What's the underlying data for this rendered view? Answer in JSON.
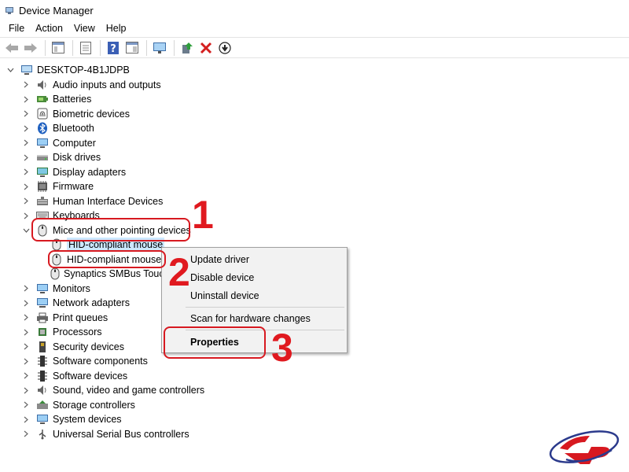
{
  "window": {
    "title": "Device Manager"
  },
  "menu": [
    "File",
    "Action",
    "View",
    "Help"
  ],
  "toolbar": [
    "back-icon",
    "forward-icon",
    "show-hide-console-tree-icon",
    "properties-icon",
    "help-icon",
    "action-pane-icon",
    "monitor-icon",
    "update-driver-icon",
    "uninstall-icon",
    "download-icon"
  ],
  "tree": {
    "root": "DESKTOP-4B1JDPB",
    "categories": [
      "Audio inputs and outputs",
      "Batteries",
      "Biometric devices",
      "Bluetooth",
      "Computer",
      "Disk drives",
      "Display adapters",
      "Firmware",
      "Human Interface Devices",
      "Keyboards",
      "Mice and other pointing devices",
      "Monitors",
      "Network adapters",
      "Print queues",
      "Processors",
      "Security devices",
      "Software components",
      "Software devices",
      "Sound, video and game controllers",
      "Storage controllers",
      "System devices",
      "Universal Serial Bus controllers"
    ],
    "mice_children": [
      "HID-compliant mouse",
      "HID-compliant mouse",
      "Synaptics SMBus Touc"
    ]
  },
  "context_menu": {
    "items": [
      "Update driver",
      "Disable device",
      "Uninstall device",
      "Scan for hardware changes",
      "Properties"
    ]
  },
  "annotations": [
    "1",
    "2",
    "3"
  ],
  "colors": {
    "callout": "#d71920",
    "selection": "#cce8ff",
    "menu_bg": "#f2f2f2"
  }
}
